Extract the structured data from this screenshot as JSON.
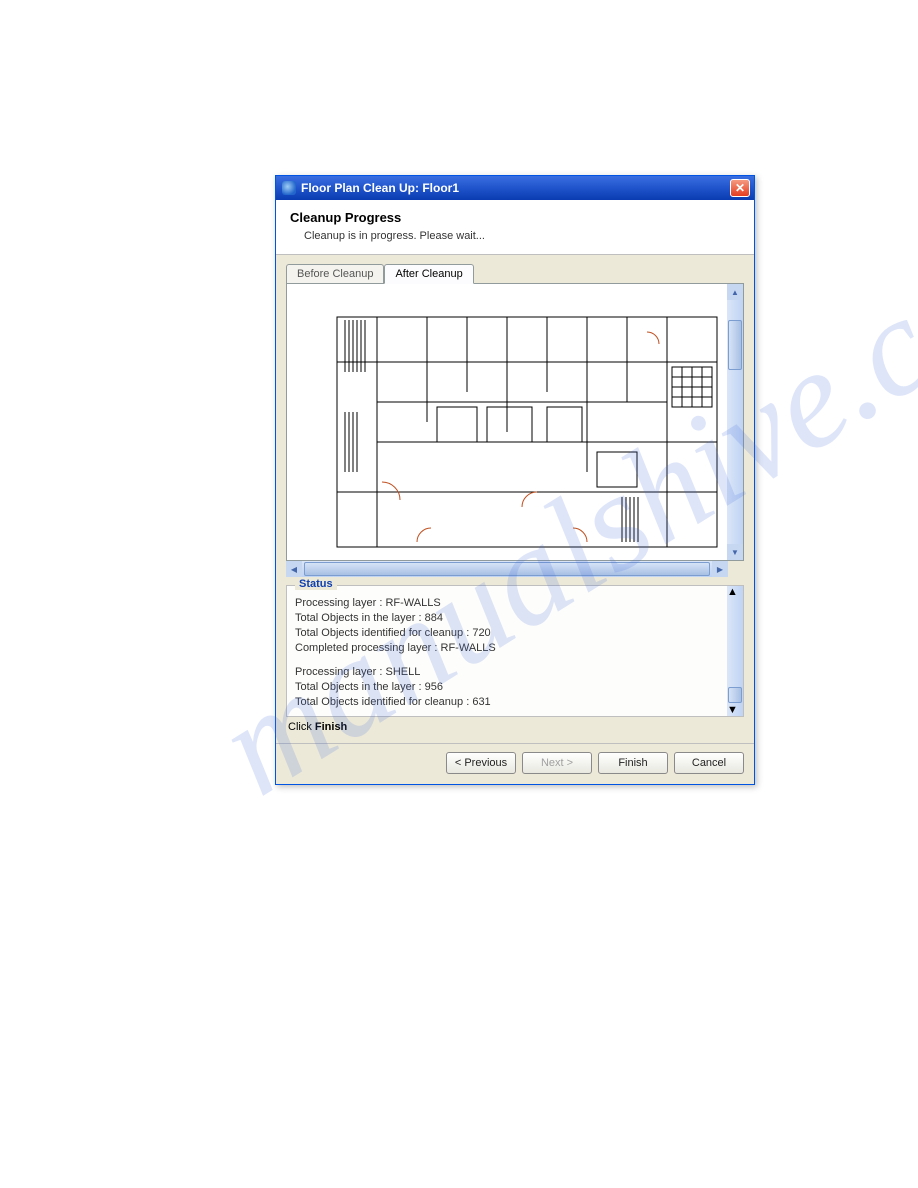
{
  "titlebar": {
    "text": "Floor Plan Clean Up: Floor1"
  },
  "header": {
    "heading": "Cleanup Progress",
    "sub": "Cleanup is in progress. Please wait..."
  },
  "tabs": {
    "before": "Before Cleanup",
    "after": "After Cleanup"
  },
  "status": {
    "label": "Status",
    "lines": [
      "Processing layer : RF-WALLS",
      "Total Objects in the layer : 884",
      "Total Objects identified for cleanup : 720",
      "Completed processing layer : RF-WALLS",
      "",
      "Processing layer : SHELL",
      "Total Objects in the layer : 956",
      "Total Objects identified for cleanup : 631"
    ]
  },
  "hint": {
    "prefix": "Click ",
    "bold": "Finish"
  },
  "buttons": {
    "previous": "< Previous",
    "next": "Next >",
    "finish": "Finish",
    "cancel": "Cancel"
  },
  "watermark": "manualshive.com"
}
